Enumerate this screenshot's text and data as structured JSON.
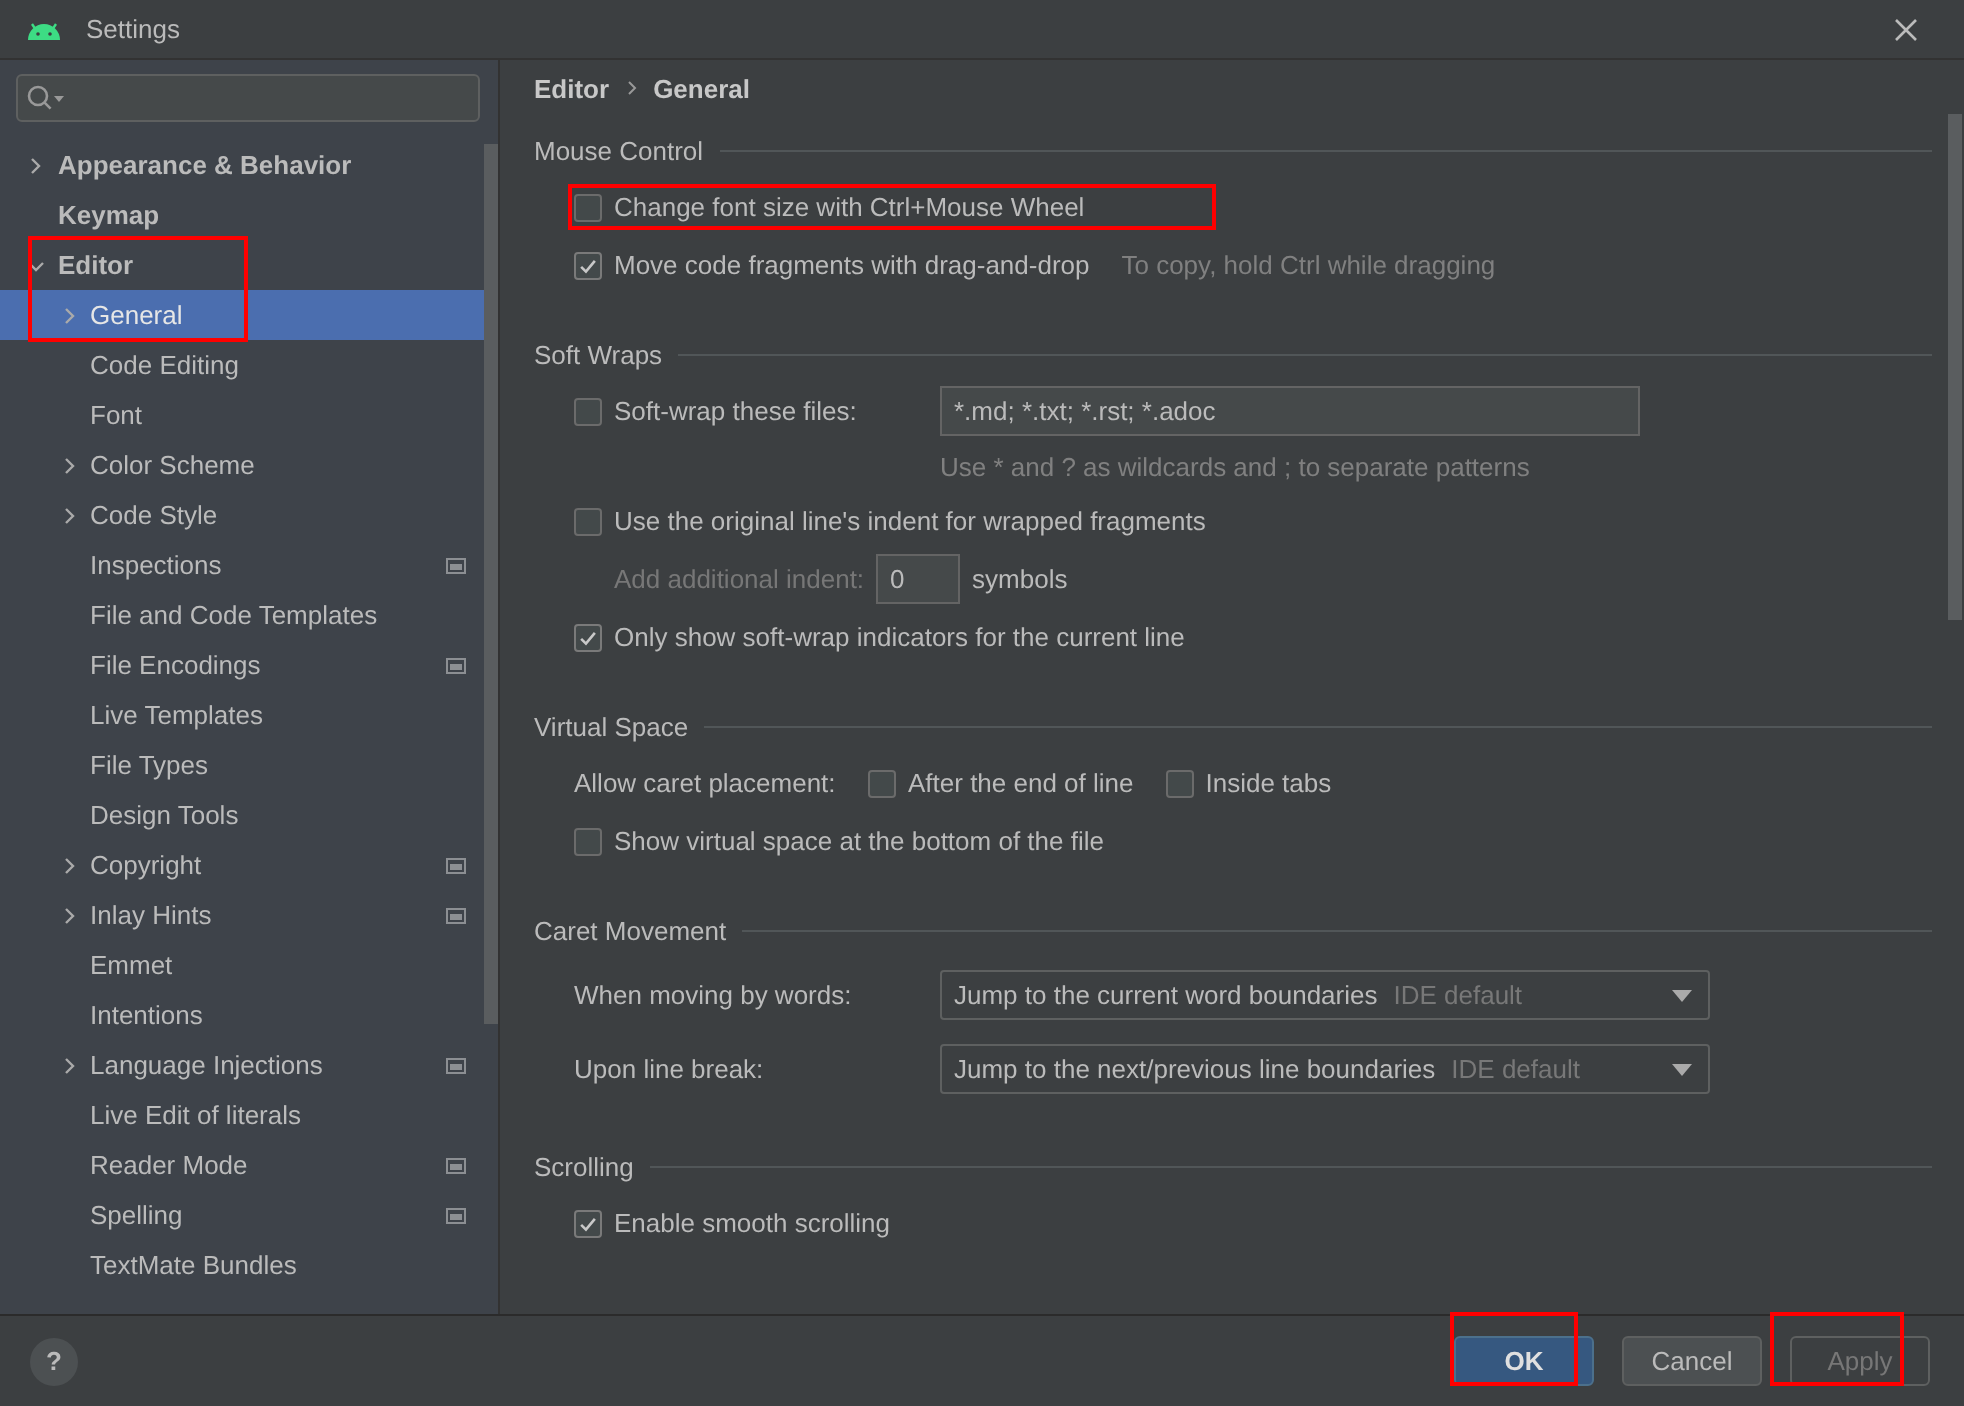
{
  "window": {
    "title": "Settings"
  },
  "sidebar": {
    "search": {
      "kind": "search"
    },
    "items": [
      {
        "label": "Appearance & Behavior",
        "bold": true,
        "expanded": false,
        "selected": false
      },
      {
        "label": "Keymap",
        "bold": true,
        "selected": false
      },
      {
        "label": "Editor",
        "bold": true,
        "expanded": true,
        "selected": false,
        "annotated": true,
        "children": [
          {
            "label": "General",
            "expanded": false,
            "selected": true
          },
          {
            "label": "Code Editing",
            "selected": false
          },
          {
            "label": "Font",
            "selected": false
          },
          {
            "label": "Color Scheme",
            "expanded": false,
            "selected": false
          },
          {
            "label": "Code Style",
            "expanded": false,
            "selected": false
          },
          {
            "label": "Inspections",
            "selected": false,
            "badge": true
          },
          {
            "label": "File and Code Templates",
            "selected": false
          },
          {
            "label": "File Encodings",
            "selected": false,
            "badge": true
          },
          {
            "label": "Live Templates",
            "selected": false
          },
          {
            "label": "File Types",
            "selected": false
          },
          {
            "label": "Design Tools",
            "selected": false
          },
          {
            "label": "Copyright",
            "expanded": false,
            "selected": false,
            "badge": true
          },
          {
            "label": "Inlay Hints",
            "expanded": false,
            "selected": false,
            "badge": true
          },
          {
            "label": "Emmet",
            "selected": false
          },
          {
            "label": "Intentions",
            "selected": false
          },
          {
            "label": "Language Injections",
            "expanded": false,
            "selected": false,
            "badge": true
          },
          {
            "label": "Live Edit of literals",
            "selected": false
          },
          {
            "label": "Reader Mode",
            "selected": false,
            "badge": true
          },
          {
            "label": "Spelling",
            "selected": false,
            "badge": true
          },
          {
            "label": "TextMate Bundles",
            "selected": false
          }
        ]
      }
    ]
  },
  "breadcrumb": [
    "Editor",
    "General"
  ],
  "sections": [
    {
      "title": "Mouse Control",
      "rows": [
        {
          "kind": "checkbox",
          "label": "Change font size with Ctrl+Mouse Wheel",
          "checked": false,
          "annotated": true
        },
        {
          "kind": "checkbox",
          "label": "Move code fragments with drag-and-drop",
          "checked": true,
          "note": "To copy, hold Ctrl while dragging"
        }
      ]
    },
    {
      "title": "Soft Wraps",
      "rows": [
        {
          "kind": "checkbox_field",
          "label": "Soft-wrap these files:",
          "checked": false,
          "value": "*.md; *.txt; *.rst; *.adoc",
          "note": "Use * and ? as wildcards and ; to separate patterns"
        },
        {
          "kind": "checkbox",
          "label": "Use the original line's indent for wrapped fragments",
          "checked": false
        },
        {
          "kind": "number_field",
          "label": "Add additional indent:",
          "value": "0",
          "unit": "symbols",
          "disabled": true
        },
        {
          "kind": "checkbox",
          "label": "Only show soft-wrap indicators for the current line",
          "checked": true
        }
      ]
    },
    {
      "title": "Virtual Space",
      "rows": [
        {
          "kind": "checkbox_group",
          "label": "Allow caret placement:",
          "options": [
            {
              "label": "After the end of line",
              "checked": false
            },
            {
              "label": "Inside tabs",
              "checked": false
            }
          ]
        },
        {
          "kind": "checkbox",
          "label": "Show virtual space at the bottom of the file",
          "checked": false
        }
      ]
    },
    {
      "title": "Caret Movement",
      "rows": [
        {
          "kind": "dropdown",
          "label": "When moving by words:",
          "value": "Jump to the current word boundaries",
          "hint": "IDE default"
        },
        {
          "kind": "dropdown",
          "label": "Upon line break:",
          "value": "Jump to the next/previous line boundaries",
          "hint": "IDE default"
        }
      ]
    },
    {
      "title": "Scrolling",
      "rows": [
        {
          "kind": "checkbox",
          "label": "Enable smooth scrolling",
          "checked": true
        }
      ]
    }
  ],
  "footer": {
    "help": "?",
    "buttons": [
      {
        "label": "OK",
        "kind": "default",
        "disabled": false,
        "annotated": true
      },
      {
        "label": "Cancel",
        "kind": "normal",
        "disabled": false
      },
      {
        "label": "Apply",
        "kind": "normal",
        "disabled": true,
        "annotated": true
      }
    ]
  }
}
